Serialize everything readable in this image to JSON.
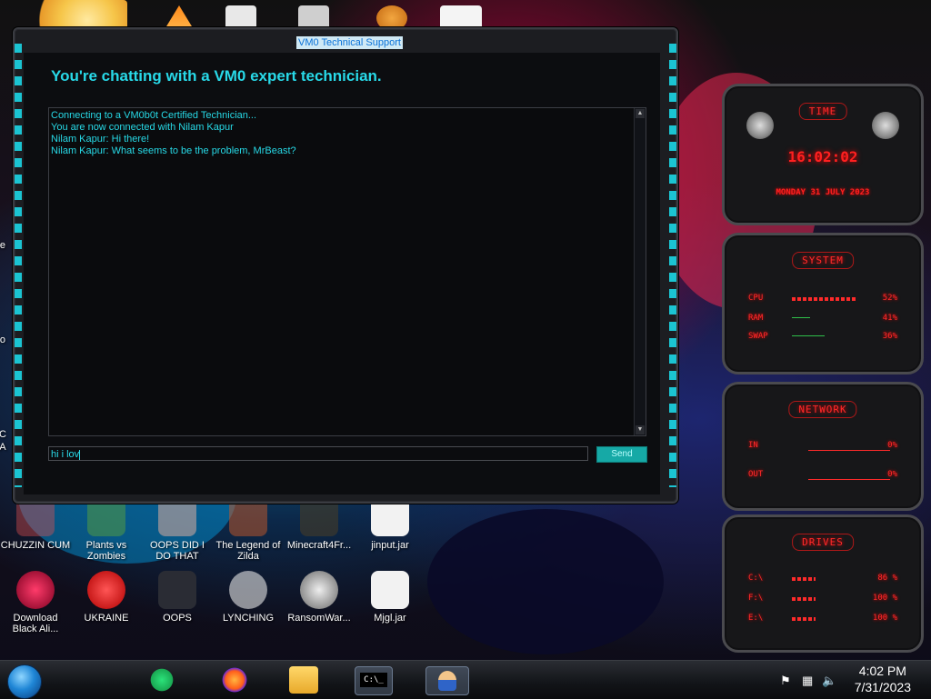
{
  "window": {
    "title": "VM0 Technical Support",
    "heading": "You're chatting with a VM0 expert technician.",
    "log": [
      "Connecting to a VM0b0t Certified Technician...",
      "You are now connected with Nilam Kapur",
      "Nilam Kapur: Hi there!",
      "Nilam Kapur: What seems to be the problem, MrBeast?"
    ],
    "input_value": "hi i lov",
    "send_label": "Send"
  },
  "desktop_icons": [
    {
      "label": "CHUZZIN CUM",
      "icon": "game-icon"
    },
    {
      "label": "Plants vs Zombies",
      "icon": "game-icon"
    },
    {
      "label": "OOPS DID I DO THAT",
      "icon": "image-icon"
    },
    {
      "label": "The Legend of Zilda",
      "icon": "game-icon"
    },
    {
      "label": "Minecraft4Fr...",
      "icon": "game-icon"
    },
    {
      "label": "jinput.jar",
      "icon": "java-icon"
    },
    {
      "label": "Download Black Ali...",
      "icon": "skull-icon"
    },
    {
      "label": "UKRAINE",
      "icon": "radiation-icon"
    },
    {
      "label": "OOPS",
      "icon": "phone-icon"
    },
    {
      "label": "LYNCHING",
      "icon": "rope-icon"
    },
    {
      "label": "RansomWar...",
      "icon": "skull-icon"
    },
    {
      "label": "Mjgl.jar",
      "icon": "java-icon"
    }
  ],
  "left_partial_labels": [
    "Re",
    "Co",
    "CC",
    "HA"
  ],
  "gadgets": {
    "time": {
      "title": "TIME",
      "clock": "16:02:02",
      "date": "MONDAY 31 JULY 2023"
    },
    "system": {
      "title": "SYSTEM",
      "rows": [
        {
          "label": "CPU",
          "value": "52%"
        },
        {
          "label": "RAM",
          "value": "41%"
        },
        {
          "label": "SWAP",
          "value": "36%"
        }
      ]
    },
    "network": {
      "title": "NETWORK",
      "rows": [
        {
          "label": "IN",
          "value": "0%"
        },
        {
          "label": "OUT",
          "value": "0%"
        }
      ]
    },
    "drives": {
      "title": "DRIVES",
      "rows": [
        {
          "label": "C:\\",
          "value": "86 %"
        },
        {
          "label": "F:\\",
          "value": "100 %"
        },
        {
          "label": "E:\\",
          "value": "100 %"
        }
      ]
    }
  },
  "taskbar": {
    "apps": [
      "spotify-icon",
      "firefox-icon",
      "folder-icon",
      "cmd-icon",
      "support-agent-icon"
    ],
    "tray_icons": [
      "flag-icon",
      "network-icon",
      "volume-icon"
    ],
    "time": "4:02 PM",
    "date": "7/31/2023"
  }
}
